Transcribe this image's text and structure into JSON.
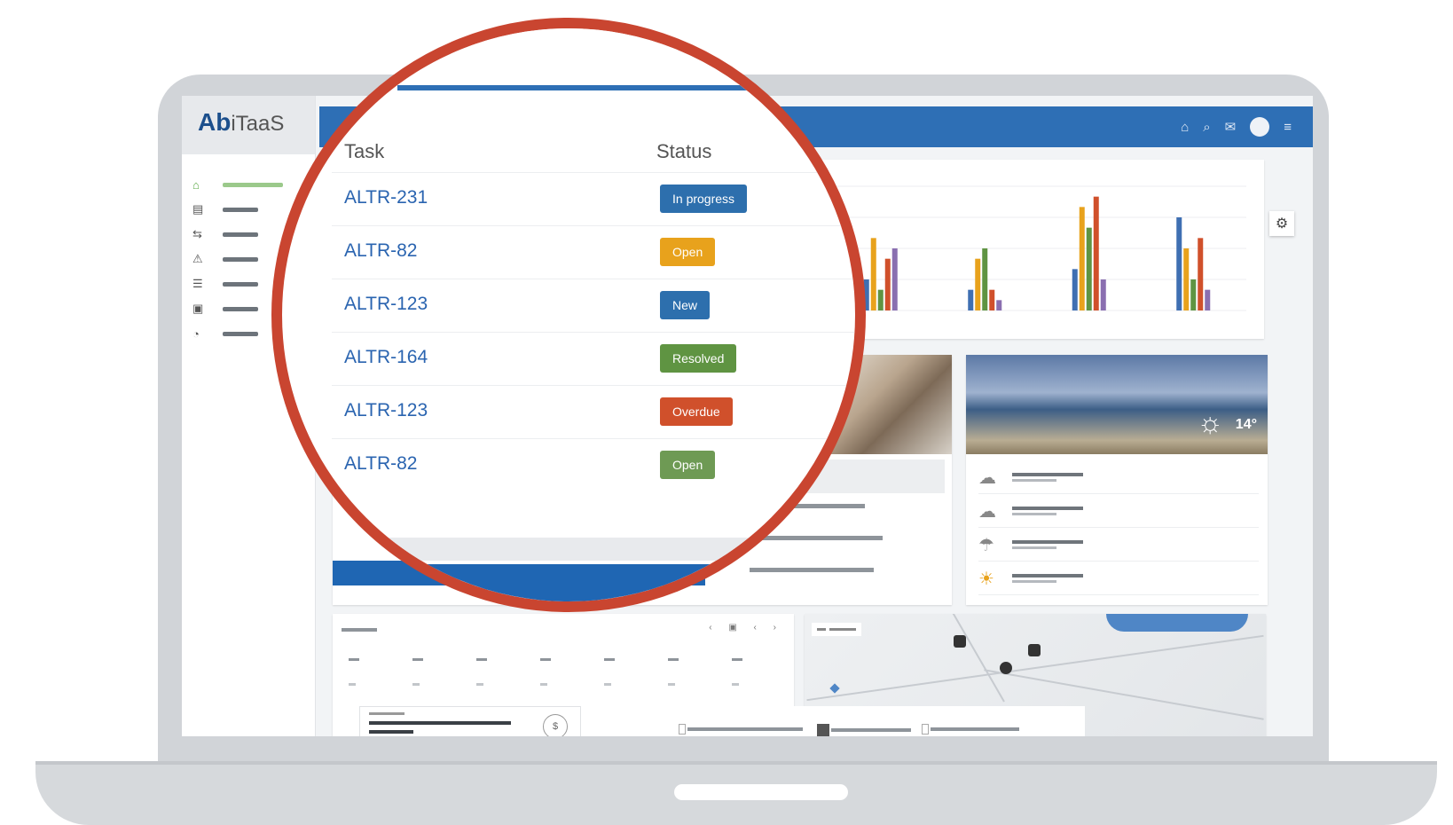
{
  "app": {
    "logo_mark": "Ab",
    "logo_text": "iTaaS"
  },
  "topbar": {
    "icons": [
      "bell-icon",
      "search-icon",
      "notifications-icon",
      "avatar",
      "menu-icon"
    ],
    "glyphs": [
      "⌂",
      "⌕",
      "✉",
      "",
      "≡"
    ]
  },
  "sidebar": {
    "items": [
      {
        "icon": "⌂",
        "active": true
      },
      {
        "icon": "▤",
        "active": false
      },
      {
        "icon": "⇆",
        "active": false
      },
      {
        "icon": "⚠",
        "active": false
      },
      {
        "icon": "☰",
        "active": false
      },
      {
        "icon": "▣",
        "active": false
      },
      {
        "icon": "◔",
        "active": false
      }
    ]
  },
  "lens": {
    "header_task": "Task",
    "header_status": "Status",
    "rows": [
      {
        "task": "ALTR-231",
        "status": "In progress",
        "color": "#2d6fad"
      },
      {
        "task": "ALTR-82",
        "status": "Open",
        "color": "#e8a21c"
      },
      {
        "task": "ALTR-123",
        "status": "New",
        "color": "#2d6fad"
      },
      {
        "task": "ALTR-164",
        "status": "Resolved",
        "color": "#5f9442"
      },
      {
        "task": "ALTR-123",
        "status": "Overdue",
        "color": "#d0502b"
      },
      {
        "task": "ALTR-82",
        "status": "Open",
        "color": "#6e9a54"
      }
    ]
  },
  "chart_data": {
    "type": "bar",
    "categories": [
      "",
      "",
      "",
      ""
    ],
    "series": [
      {
        "values": [
          3,
          2,
          4,
          9
        ],
        "color": "#3f6fb2"
      },
      {
        "values": [
          7,
          5,
          10,
          6
        ],
        "color": "#e8a21c"
      },
      {
        "values": [
          2,
          6,
          8,
          3
        ],
        "color": "#5f9442"
      },
      {
        "values": [
          5,
          2,
          11,
          7
        ],
        "color": "#d0502b"
      },
      {
        "values": [
          6,
          1,
          3,
          2
        ],
        "color": "#8a6fb0"
      }
    ],
    "ylim": [
      0,
      12
    ],
    "grid": true
  },
  "weather": {
    "temp": "14°",
    "rows": [
      {
        "icon": "☁",
        "l1": "",
        "l2": ""
      },
      {
        "icon": "☁",
        "l1": "",
        "l2": ""
      },
      {
        "icon": "☂",
        "l1": "",
        "l2": ""
      },
      {
        "icon": "☀",
        "l1": "",
        "l2": ""
      }
    ]
  },
  "calendar": {
    "controls": "‹ ▣ ‹ ›"
  },
  "ticker": {
    "badge_glyph": "$"
  }
}
